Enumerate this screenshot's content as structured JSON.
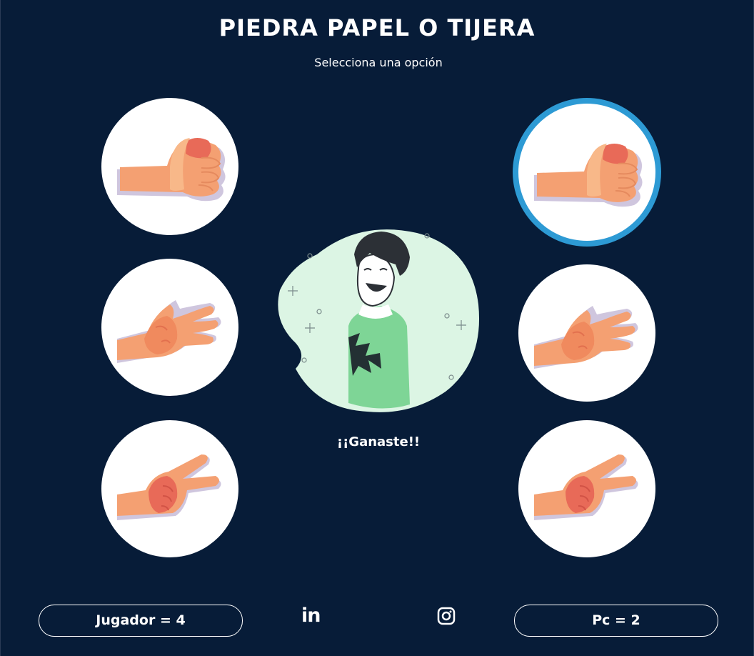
{
  "header": {
    "title": "PIEDRA PAPEL O TIJERA",
    "subtitle": "Selecciona una opción"
  },
  "player_choices": [
    {
      "name": "piedra",
      "icon": "fist-hand-icon"
    },
    {
      "name": "papel",
      "icon": "open-hand-icon"
    },
    {
      "name": "tijera",
      "icon": "scissors-hand-icon"
    }
  ],
  "pc_choices": [
    {
      "name": "piedra",
      "icon": "fist-hand-icon",
      "selected": true
    },
    {
      "name": "papel",
      "icon": "open-hand-icon",
      "selected": false
    },
    {
      "name": "tijera",
      "icon": "scissors-hand-icon",
      "selected": false
    }
  ],
  "result": {
    "text": "¡¡Ganaste!!",
    "illustration": "laughing-man-illustration"
  },
  "footer": {
    "player_score": "Jugador = 4",
    "pc_score": "Pc = 2",
    "linkedin_label": "in",
    "links": [
      "linkedin-icon",
      "instagram-icon"
    ]
  },
  "colors": {
    "background": "#071c38",
    "selected_ring": "#2d9ad4",
    "skin": "#f4a072",
    "illustration_bg": "#dcf5e4",
    "sweater": "#7ed596"
  }
}
